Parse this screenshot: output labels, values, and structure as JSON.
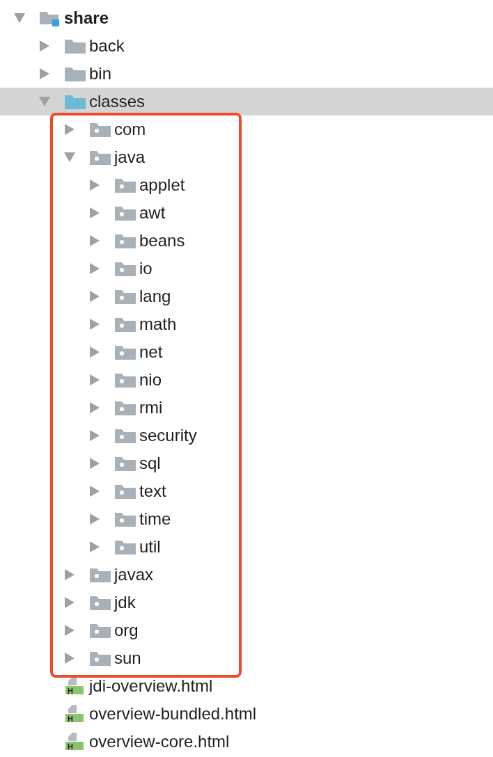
{
  "tree": [
    {
      "label": "share",
      "kind": "module",
      "bold": true,
      "expanded": true,
      "selected": false,
      "children": [
        {
          "label": "back",
          "kind": "folder",
          "expanded": false,
          "selected": false
        },
        {
          "label": "bin",
          "kind": "folder",
          "expanded": false,
          "selected": false
        },
        {
          "label": "classes",
          "kind": "source_root",
          "expanded": true,
          "selected": true,
          "highlighted": true,
          "children": [
            {
              "label": "com",
              "kind": "package",
              "expanded": false,
              "selected": false
            },
            {
              "label": "java",
              "kind": "package",
              "expanded": true,
              "selected": false,
              "children": [
                {
                  "label": "applet",
                  "kind": "package",
                  "expanded": false,
                  "selected": false
                },
                {
                  "label": "awt",
                  "kind": "package",
                  "expanded": false,
                  "selected": false
                },
                {
                  "label": "beans",
                  "kind": "package",
                  "expanded": false,
                  "selected": false
                },
                {
                  "label": "io",
                  "kind": "package",
                  "expanded": false,
                  "selected": false
                },
                {
                  "label": "lang",
                  "kind": "package",
                  "expanded": false,
                  "selected": false
                },
                {
                  "label": "math",
                  "kind": "package",
                  "expanded": false,
                  "selected": false
                },
                {
                  "label": "net",
                  "kind": "package",
                  "expanded": false,
                  "selected": false
                },
                {
                  "label": "nio",
                  "kind": "package",
                  "expanded": false,
                  "selected": false
                },
                {
                  "label": "rmi",
                  "kind": "package",
                  "expanded": false,
                  "selected": false
                },
                {
                  "label": "security",
                  "kind": "package",
                  "expanded": false,
                  "selected": false
                },
                {
                  "label": "sql",
                  "kind": "package",
                  "expanded": false,
                  "selected": false
                },
                {
                  "label": "text",
                  "kind": "package",
                  "expanded": false,
                  "selected": false
                },
                {
                  "label": "time",
                  "kind": "package",
                  "expanded": false,
                  "selected": false
                },
                {
                  "label": "util",
                  "kind": "package",
                  "expanded": false,
                  "selected": false
                }
              ]
            },
            {
              "label": "javax",
              "kind": "package",
              "expanded": false,
              "selected": false
            },
            {
              "label": "jdk",
              "kind": "package",
              "expanded": false,
              "selected": false
            },
            {
              "label": "org",
              "kind": "package",
              "expanded": false,
              "selected": false
            },
            {
              "label": "sun",
              "kind": "package",
              "expanded": false,
              "selected": false
            }
          ]
        },
        {
          "label": "jdi-overview.html",
          "kind": "html",
          "badge": "H",
          "selected": false
        },
        {
          "label": "overview-bundled.html",
          "kind": "html",
          "badge": "H",
          "selected": false
        },
        {
          "label": "overview-core.html",
          "kind": "html",
          "badge": "H",
          "selected": false
        }
      ]
    }
  ]
}
